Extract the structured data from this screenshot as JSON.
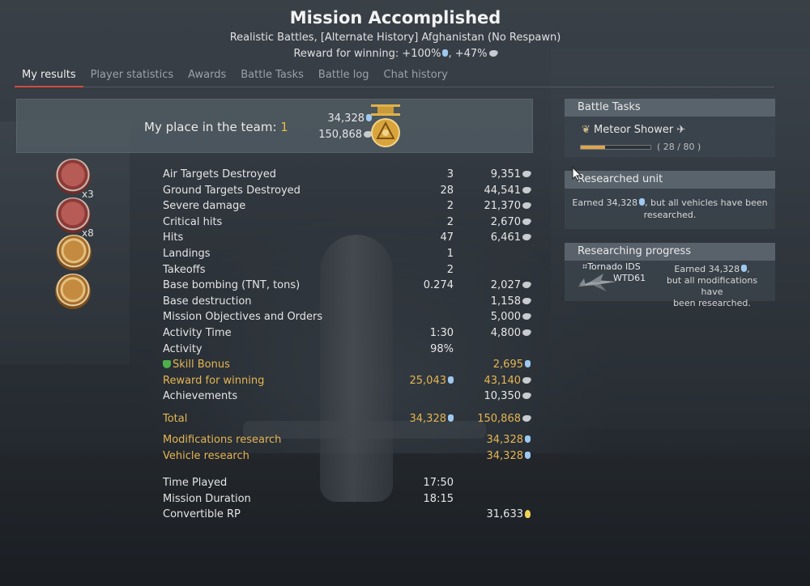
{
  "header": {
    "title": "Mission Accomplished",
    "subtitle": "Realistic Battles, [Alternate History] Afghanistan (No Respawn)",
    "reward_prefix": "Reward for winning: +100%",
    "reward_suffix": ", +47%"
  },
  "tabs": [
    {
      "label": "My results",
      "active": true
    },
    {
      "label": "Player statistics",
      "active": false
    },
    {
      "label": "Awards",
      "active": false
    },
    {
      "label": "Battle Tasks",
      "active": false
    },
    {
      "label": "Battle log",
      "active": false
    },
    {
      "label": "Chat history",
      "active": false
    }
  ],
  "place": {
    "label": "My place in the team: ",
    "value": "1",
    "rp": "34,328",
    "sl": "150,868"
  },
  "achievements": [
    {
      "icon": "tank-kill-medal-icon",
      "multiplier": "x3"
    },
    {
      "icon": "tank-kill-medal-icon",
      "multiplier": "x8"
    },
    {
      "icon": "bomber-medal-icon",
      "multiplier": ""
    },
    {
      "icon": "base-destruction-medal-icon",
      "multiplier": ""
    }
  ],
  "results": [
    {
      "label": "Air Targets Destroyed",
      "c1": "3",
      "c2": "9,351",
      "c2_icon": "sl"
    },
    {
      "label": "Ground Targets Destroyed",
      "c1": "28",
      "c2": "44,541",
      "c2_icon": "sl"
    },
    {
      "label": "Severe damage",
      "c1": "2",
      "c2": "21,370",
      "c2_icon": "sl"
    },
    {
      "label": "Critical hits",
      "c1": "2",
      "c2": "2,670",
      "c2_icon": "sl"
    },
    {
      "label": "Hits",
      "c1": "47",
      "c2": "6,461",
      "c2_icon": "sl"
    },
    {
      "label": "Landings",
      "c1": "1",
      "c2": "",
      "c2_icon": ""
    },
    {
      "label": "Takeoffs",
      "c1": "2",
      "c2": "",
      "c2_icon": ""
    },
    {
      "label": "Base bombing (TNT, tons)",
      "c1": "0.274",
      "c2": "2,027",
      "c2_icon": "sl"
    },
    {
      "label": "Base destruction",
      "c1": "",
      "c2": "1,158",
      "c2_icon": "sl"
    },
    {
      "label": "Mission Objectives and Orders",
      "c1": "",
      "c2": "5,000",
      "c2_icon": "sl"
    },
    {
      "label": "Activity Time",
      "c1": "1:30",
      "c2": "4,800",
      "c2_icon": "sl"
    },
    {
      "label": "Activity",
      "c1": "98%",
      "c2": "",
      "c2_icon": ""
    },
    {
      "label": "Skill Bonus",
      "c1": "",
      "c2": "2,695",
      "c2_icon": "rp",
      "style": "gold",
      "prefix_icon": "skill-bonus-icon"
    },
    {
      "label": "Reward for winning",
      "c1": "25,043",
      "c1_icon": "rp",
      "c2": "43,140",
      "c2_icon": "sl",
      "style": "gold"
    },
    {
      "label": "Achievements",
      "c1": "",
      "c2": "10,350",
      "c2_icon": "sl"
    }
  ],
  "total": {
    "label": "Total",
    "c1": "34,328",
    "c2": "150,868"
  },
  "research": [
    {
      "label": "Modifications research",
      "c2": "34,328"
    },
    {
      "label": "Vehicle research",
      "c2": "34,328"
    }
  ],
  "time_rows": [
    {
      "label": "Time Played",
      "c1": "17:50",
      "c2": "",
      "c2_icon": ""
    },
    {
      "label": "Mission Duration",
      "c1": "18:15",
      "c2": "",
      "c2_icon": ""
    },
    {
      "label": "Convertible RP",
      "c1": "",
      "c2": "31,633",
      "c2_icon": "crp"
    }
  ],
  "battle_tasks": {
    "title": "Battle Tasks",
    "task_name": "Meteor Shower",
    "progress_text": "( 28 / 80 )",
    "progress_fraction": 0.35
  },
  "researched_unit": {
    "title": "Researched unit",
    "msg_line1_a": "Earned 34,328",
    "msg_line1_b": ", but all vehicles have been",
    "msg_line2": "researched."
  },
  "researching_progress": {
    "title": "Researching progress",
    "unit_line1": "⌗Tornado IDS",
    "unit_line2": "WTD61",
    "msg_line1": "Earned 34,328",
    "msg_line2": "but all modifications have",
    "msg_line3": "been researched."
  },
  "colors": {
    "accent_gold": "#e5b553",
    "tab_underline": "#d24b3a",
    "rp_blue": "#9ec8ef"
  }
}
